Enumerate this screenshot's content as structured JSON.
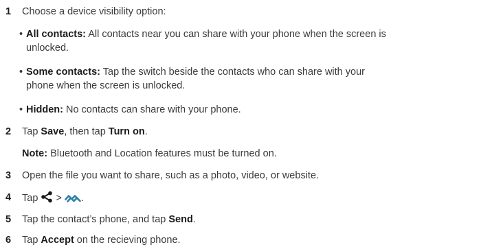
{
  "steps": [
    {
      "num": "1",
      "text": "Choose a device visibility option:"
    },
    {
      "num": "2",
      "pre": "Tap ",
      "bold1": "Save",
      "mid": ", then tap ",
      "bold2": "Turn on",
      "post": "."
    },
    {
      "num": "3",
      "text": "Open the file you want to share, such as a photo, video, or website."
    },
    {
      "num": "4",
      "pre": "Tap ",
      "mid": " > ",
      "post": "."
    },
    {
      "num": "5",
      "pre": "Tap the contact’s phone, and tap ",
      "bold1": "Send",
      "post": "."
    },
    {
      "num": "6",
      "pre": "Tap ",
      "bold1": "Accept",
      "post": " on the recieving phone."
    }
  ],
  "options": [
    {
      "bullet": "•",
      "title": "All contacts:",
      "line1": " All contacts near you can share with your phone when the screen is",
      "line2": "unlocked."
    },
    {
      "bullet": "•",
      "title": "Some contacts:",
      "line1": " Tap the switch beside the contacts who can share with your",
      "line2": "phone when the screen is unlocked."
    },
    {
      "bullet": "•",
      "title": "Hidden:",
      "line1": " No contacts can share with your phone."
    }
  ],
  "note": {
    "label": "Note:",
    "text": " Bluetooth and Location features must be turned on."
  },
  "icons": {
    "share": "share-icon",
    "nearby_share": "nearby-share-icon"
  },
  "colors": {
    "text": "#3a3a3a",
    "bold": "#1b1b1b",
    "nearby_icon": "#2a7fa8"
  }
}
